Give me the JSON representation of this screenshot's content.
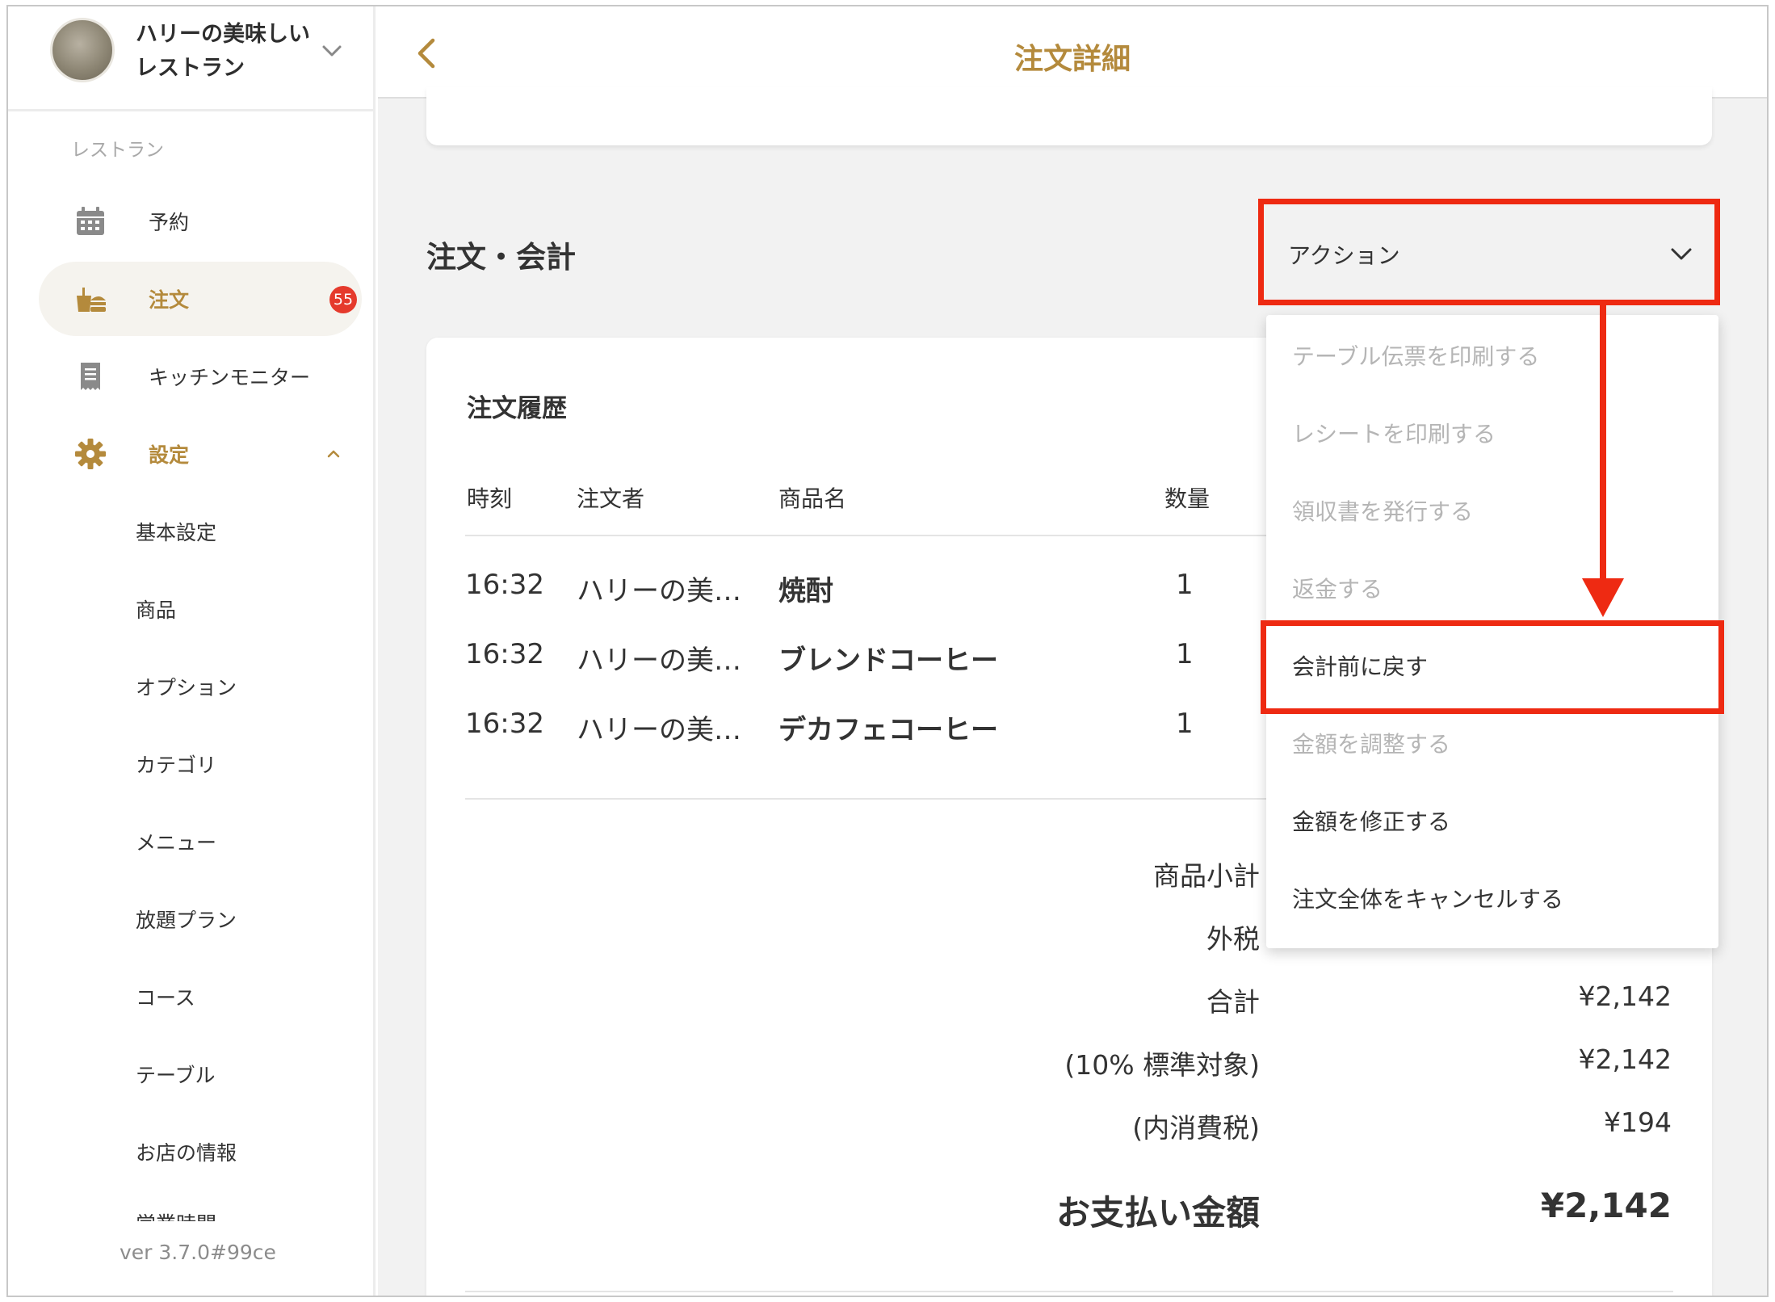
{
  "sidebar": {
    "store_name": "ハリーの美味しい\nレストラン",
    "section_label": "レストラン",
    "nav": [
      {
        "label": "予約",
        "icon": "calendar-icon"
      },
      {
        "label": "注文",
        "icon": "order-bag-icon",
        "badge": "55"
      },
      {
        "label": "キッチンモニター",
        "icon": "receipt-icon"
      },
      {
        "label": "設定",
        "icon": "gear-icon"
      }
    ],
    "settings_sub": [
      "基本設定",
      "商品",
      "オプション",
      "カテゴリ",
      "メニュー",
      "放題プラン",
      "コース",
      "テーブル",
      "お店の情報",
      "営業時間"
    ],
    "version": "ver 3.7.0#99ce"
  },
  "header": {
    "title": "注文詳細"
  },
  "order": {
    "section_title": "注文・会計",
    "action_label": "アクション",
    "history_title": "注文履歴",
    "columns": [
      "時刻",
      "注文者",
      "商品名",
      "数量"
    ],
    "rows": [
      {
        "time": "16:32",
        "orderer": "ハリーの美…",
        "product": "焼酎",
        "qty": "1"
      },
      {
        "time": "16:32",
        "orderer": "ハリーの美…",
        "product": "ブレンドコーヒー",
        "qty": "1"
      },
      {
        "time": "16:32",
        "orderer": "ハリーの美…",
        "product": "デカフェコーヒー",
        "qty": "1"
      }
    ],
    "summary": [
      {
        "label": "商品小計",
        "value": ""
      },
      {
        "label": "外税",
        "value": ""
      },
      {
        "label": "合計",
        "value": "¥2,142"
      },
      {
        "label": "(10% 標準対象)",
        "value": "¥2,142"
      },
      {
        "label": "(内消費税)",
        "value": "¥194"
      }
    ],
    "total_label": "お支払い金額",
    "total_value": "¥2,142"
  },
  "action_menu": [
    {
      "label": "テーブル伝票を印刷する",
      "enabled": false
    },
    {
      "label": "レシートを印刷する",
      "enabled": false
    },
    {
      "label": "領収書を発行する",
      "enabled": false
    },
    {
      "label": "返金する",
      "enabled": false
    },
    {
      "label": "会計前に戻す",
      "enabled": true
    },
    {
      "label": "金額を調整する",
      "enabled": false
    },
    {
      "label": "金額を修正する",
      "enabled": true
    },
    {
      "label": "注文全体をキャンセルする",
      "enabled": true
    }
  ],
  "colors": {
    "accent_gold": "#b48a3c",
    "highlight_red": "#ee2a12",
    "badge_red": "#e53a2c"
  }
}
